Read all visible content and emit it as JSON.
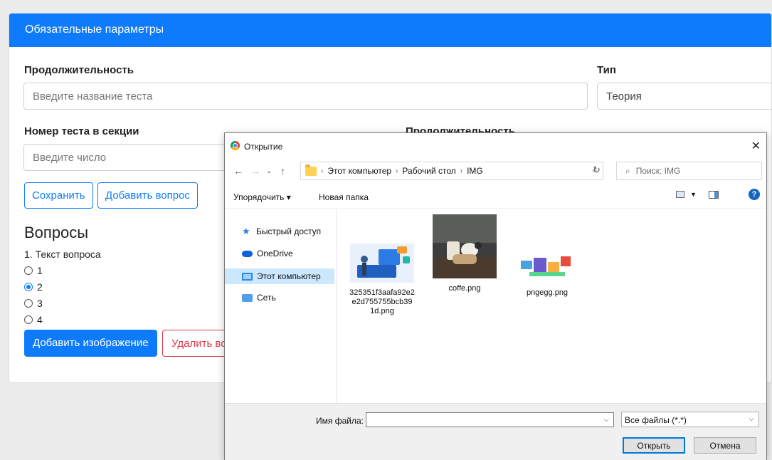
{
  "card": {
    "header": "Обязательные параметры",
    "duration_label": "Продолжительность",
    "name_placeholder": "Введите название теста",
    "type_label": "Тип",
    "type_value": "Теория",
    "number_label": "Номер теста в секции",
    "number_placeholder": "Введите число",
    "duration2_label": "Продолжительность",
    "save_button": "Сохранить",
    "add_question_button": "Добавить вопрос",
    "questions_title": "Вопросы",
    "question_text": "1. Текст вопроса",
    "options": [
      {
        "label": "1",
        "selected": false
      },
      {
        "label": "2",
        "selected": true
      },
      {
        "label": "3",
        "selected": false
      },
      {
        "label": "4",
        "selected": false
      }
    ],
    "add_image_button": "Добавить изображение",
    "delete_button": "Удалить во"
  },
  "dialog": {
    "title": "Открытие",
    "breadcrumb": [
      "Этот компьютер",
      "Рабочий стол",
      "IMG"
    ],
    "search_placeholder": "Поиск: IMG",
    "organize": "Упорядочить ▾",
    "new_folder": "Новая папка",
    "sidebar": [
      {
        "label": "Быстрый доступ",
        "icon": "star-icon",
        "selected": false
      },
      {
        "label": "OneDrive",
        "icon": "cloud-icon",
        "selected": false
      },
      {
        "label": "Этот компьютер",
        "icon": "computer-icon",
        "selected": true
      },
      {
        "label": "Сеть",
        "icon": "network-icon",
        "selected": false
      }
    ],
    "files": [
      {
        "name": "325351f3aafa92e2e2d755755bcb391d.png",
        "line1": "325351f3aafa92e2",
        "line2": "e2d755755bcb39",
        "line3": "1d.png"
      },
      {
        "name": "coffe.png"
      },
      {
        "name": "pngegg.png"
      }
    ],
    "filename_label": "Имя файла:",
    "filetype": "Все файлы (*.*)",
    "open_button": "Открыть",
    "cancel_button": "Отмена"
  }
}
